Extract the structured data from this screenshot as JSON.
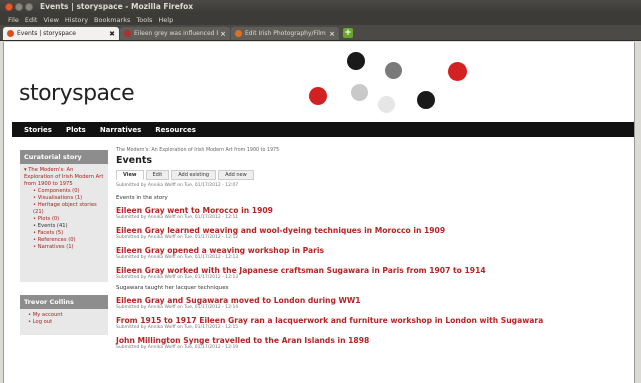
{
  "window": {
    "title": "Events | storyspace - Mozilla Firefox"
  },
  "menu": [
    "File",
    "Edit",
    "View",
    "History",
    "Bookmarks",
    "Tools",
    "Help"
  ],
  "tabs": [
    {
      "label": "Events | storyspace",
      "close": "✖"
    },
    {
      "label": "Eileen grey was influenced b...",
      "close": "×"
    },
    {
      "label": "Edit Irish Photography/Film | ...",
      "close": "×"
    }
  ],
  "new_tab": "+",
  "site": {
    "logo": "storyspace",
    "pin_colors": [
      "#1a1a1a",
      "#7a7a7a",
      "#d32020",
      "#c9c9c9",
      "#e6e6e6",
      "#1a1a1a",
      "#d32020"
    ],
    "nav": [
      "Stories",
      "Plots",
      "Narratives",
      "Resources"
    ]
  },
  "sidebar": {
    "curatorial": {
      "title": "Curatorial story",
      "story": "The Modern's: An Exploration of Irish Modern Art from 1900 to 1975",
      "items": [
        "Components (0)",
        "Visualisations (1)",
        "Heritage object stories (21)",
        "Plots (0)",
        "Events (41)",
        "Facets (5)",
        "References (0)",
        "Narratives (1)"
      ]
    },
    "user": {
      "title": "Trevor Collins",
      "items": [
        "My account",
        "Log out"
      ]
    }
  },
  "main": {
    "breadcrumb": "The Modern's: An Exploration of Irish Modern Art from 1900 to 1975",
    "title": "Events",
    "tabs": [
      "View",
      "Edit",
      "Add existing",
      "Add new"
    ],
    "submitted": "Submitted by Annika Wolff on Tue, 01/17/2012 - 12:07",
    "intro": "Events in the story",
    "events": [
      {
        "title": "Eileen Gray went to Morocco in 1909",
        "submitted": "Submitted by Annika Wolff on Tue, 01/17/2012 - 12:11",
        "body": ""
      },
      {
        "title": "Eileen Gray learned weaving and wool-dyeing techniques in Morocco in 1909",
        "submitted": "Submitted by Annika Wolff on Tue, 01/17/2012 - 12:12",
        "body": ""
      },
      {
        "title": "Eileen Gray opened a weaving workshop in Paris",
        "submitted": "Submitted by Annika Wolff on Tue, 01/17/2012 - 12:13",
        "body": ""
      },
      {
        "title": "Eileen Gray worked with the Japanese craftsman Sugawara in Paris from 1907 to 1914",
        "submitted": "Submitted by Annika Wolff on Tue, 01/17/2012 - 12:13",
        "body": "Sugawara taught her lacquer techniques"
      },
      {
        "title": "Eileen Gray and Sugawara moved to London during WW1",
        "submitted": "Submitted by Annika Wolff on Tue, 01/17/2012 - 12:14",
        "body": ""
      },
      {
        "title": "From 1915 to 1917 Eileen Gray ran a lacquerwork and furniture workshop in London with Sugawara",
        "submitted": "Submitted by Annika Wolff on Tue, 01/17/2012 - 12:15",
        "body": ""
      },
      {
        "title": "John Millington Synge travelled to the Aran Islands in 1898",
        "submitted": "Submitted by Annika Wolff on Tue, 01/17/2012 - 12:19",
        "body": ""
      }
    ]
  }
}
